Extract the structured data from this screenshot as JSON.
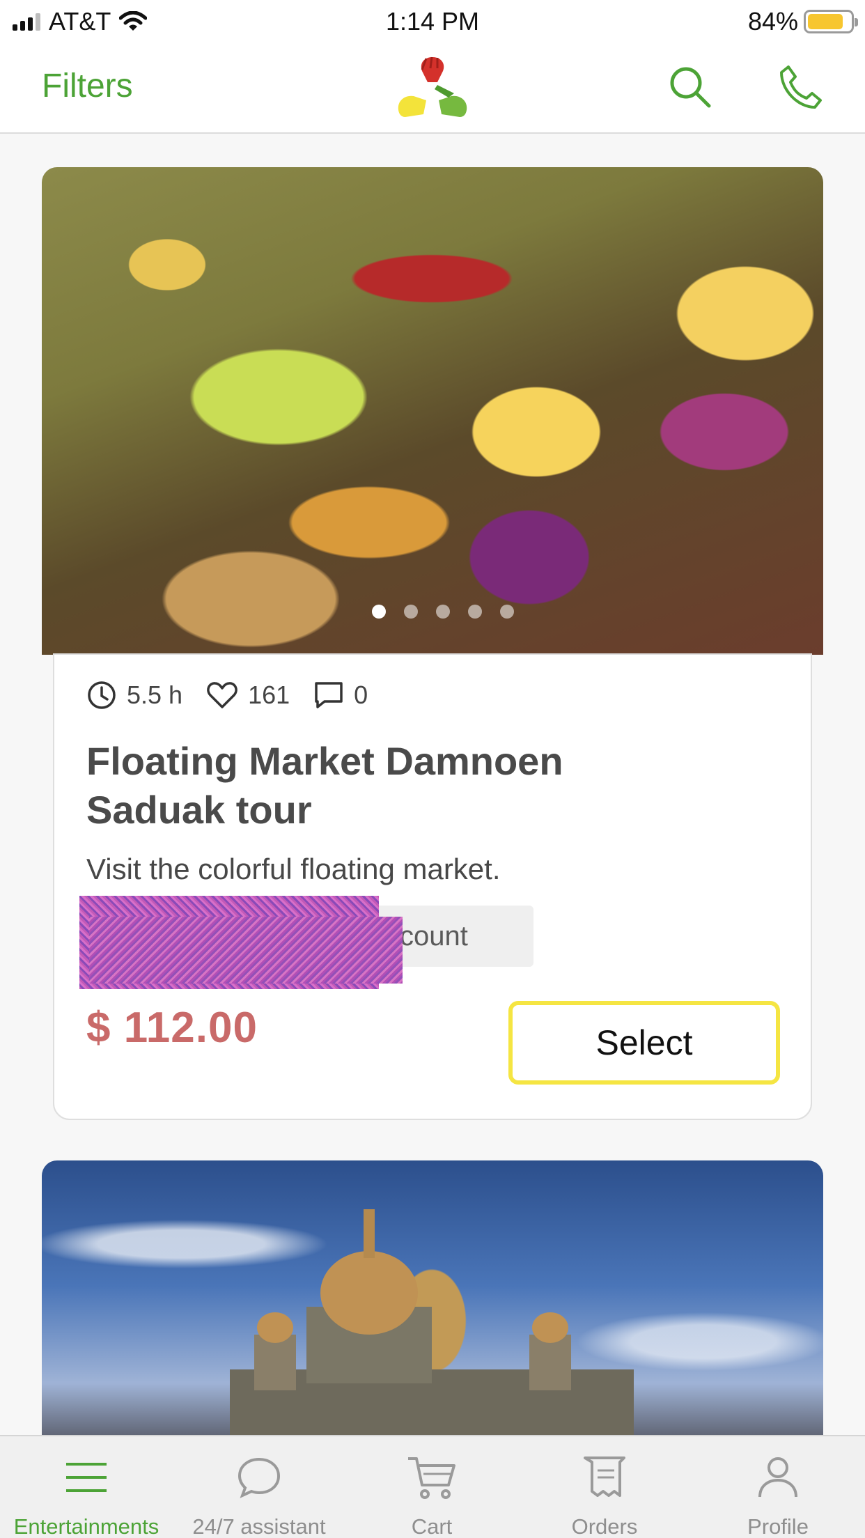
{
  "status_bar": {
    "carrier": "AT&T",
    "time": "1:14 PM",
    "battery_percent": "84%",
    "battery_level": 0.84
  },
  "nav": {
    "filters_label": "Filters",
    "logo_icon": "hands-logo-icon",
    "search_icon": "search-icon",
    "phone_icon": "phone-icon",
    "accent_color": "#4ca336"
  },
  "feed": {
    "cards": [
      {
        "photo_dots": 5,
        "active_dot": 0,
        "duration": "5.5 h",
        "likes": "161",
        "comments": "0",
        "title": "Floating Market Damnoen Saduak tour",
        "description": "Visit the colorful floating market.",
        "discount_text": "ccount",
        "price": "$ 112.00",
        "price_color": "#c96a69",
        "select_label": "Select"
      }
    ]
  },
  "tabbar": {
    "tabs": [
      {
        "label": "Entertainments",
        "icon": "menu-lines-icon",
        "active": true
      },
      {
        "label": "24/7 assistant",
        "icon": "chat-bubble-icon",
        "active": false
      },
      {
        "label": "Cart",
        "icon": "cart-icon",
        "active": false
      },
      {
        "label": "Orders",
        "icon": "receipt-icon",
        "active": false
      },
      {
        "label": "Profile",
        "icon": "person-icon",
        "active": false
      }
    ]
  }
}
